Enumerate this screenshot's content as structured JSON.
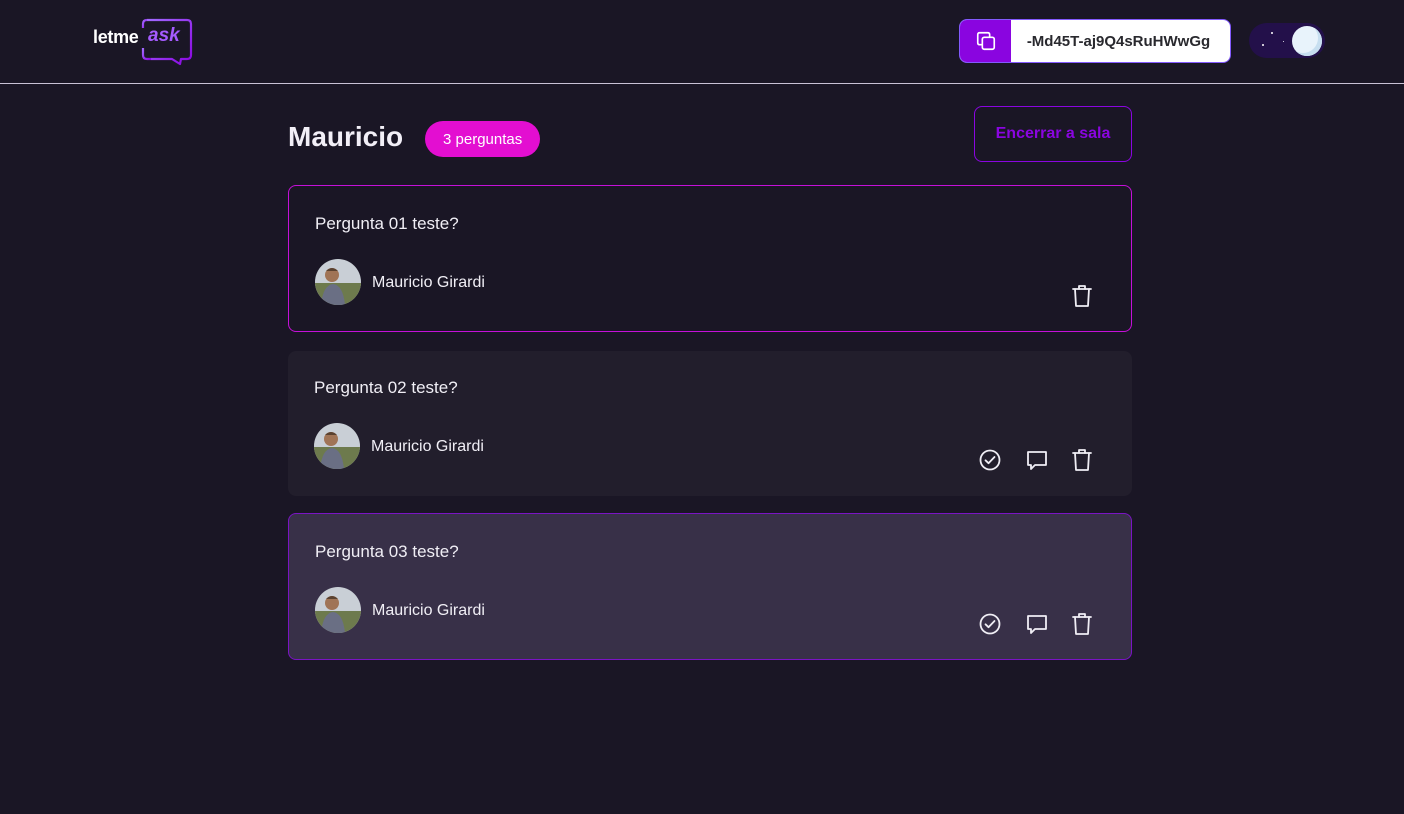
{
  "header": {
    "logo": {
      "text_a": "letme",
      "text_b": "ask"
    },
    "room_code": "-Md45T-aj9Q4sRuHWwGg",
    "theme_toggle": {
      "mode": "dark"
    }
  },
  "room": {
    "title": "Mauricio",
    "question_count_label": "3 perguntas",
    "close_button_label": "Encerrar a sala"
  },
  "questions": [
    {
      "text": "Pergunta 01 teste?",
      "author": "Mauricio Girardi",
      "actions": [
        "delete-icon"
      ]
    },
    {
      "text": "Pergunta 02 teste?",
      "author": "Mauricio Girardi",
      "actions": [
        "check-circle-icon",
        "answer-icon",
        "delete-icon"
      ]
    },
    {
      "text": "Pergunta 03 teste?",
      "author": "Mauricio Girardi",
      "actions": [
        "check-circle-icon",
        "answer-icon",
        "delete-icon"
      ]
    }
  ],
  "colors": {
    "background": "#1a1625",
    "accent_purple": "#8a05e0",
    "accent_pink": "#e30ed1",
    "highlight_card": "#383048"
  }
}
